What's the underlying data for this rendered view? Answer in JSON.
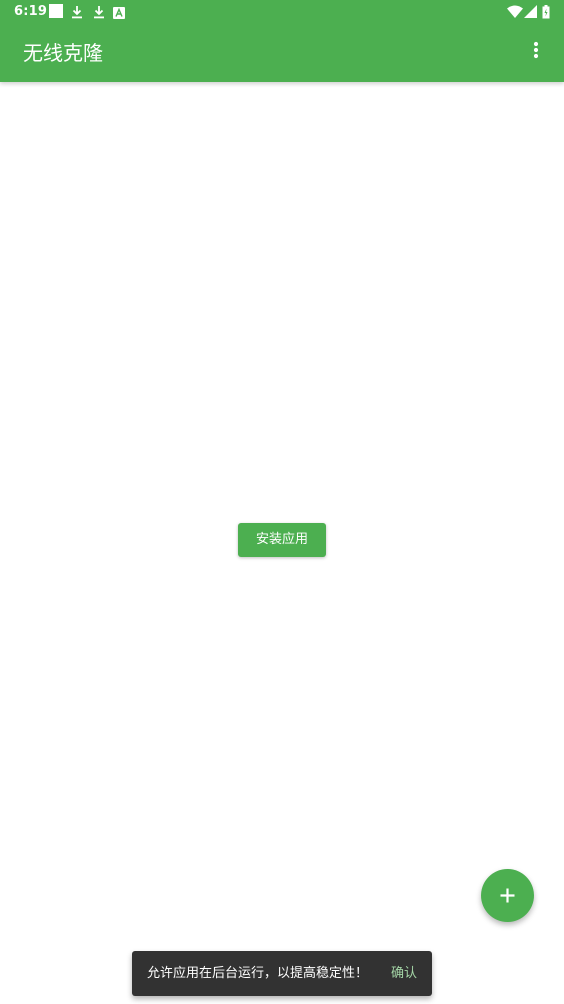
{
  "status_bar": {
    "time": "6:19",
    "icons": [
      "notification-square-icon",
      "download-icon",
      "download-icon",
      "notification-a-icon",
      "wifi-icon",
      "cell-signal-icon",
      "battery-icon"
    ]
  },
  "app_bar": {
    "title": "无线克隆",
    "menu_icon": "more-vert-icon"
  },
  "main": {
    "install_button_label": "安装应用"
  },
  "fab": {
    "icon": "add-icon"
  },
  "snackbar": {
    "message": "允许应用在后台运行，以提高稳定性！",
    "action_label": "确认"
  },
  "colors": {
    "primary": "#4caf50",
    "snackbar_bg": "#323232",
    "snackbar_action": "#a5d6a7",
    "on_primary": "#ffffff"
  }
}
